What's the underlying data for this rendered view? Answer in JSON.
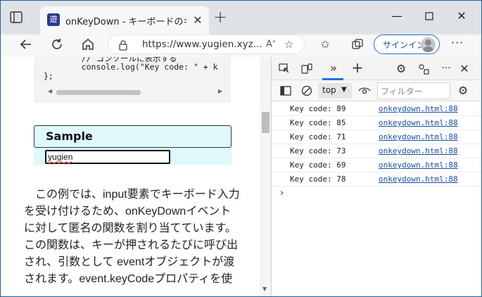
{
  "browser": {
    "tab_title": "onKeyDown - キーボードのキーが押さ",
    "favicon_char": "遊",
    "url": "https://www.yugien.xyz...",
    "signin_label": "サインイン"
  },
  "icons": {
    "tab_actions": "tab-actions-icon",
    "close": "close-icon",
    "new_tab": "plus-icon",
    "minimize": "minimize-icon",
    "maximize": "maximize-icon",
    "back": "back-arrow-icon",
    "refresh": "refresh-icon",
    "home": "home-icon",
    "lock": "lock-icon",
    "read_aloud": "read-aloud-icon",
    "add_favorite": "add-favorite-icon",
    "favorites": "favorites-icon",
    "collections": "collections-icon",
    "more": "more-icon"
  },
  "page": {
    "code_lines": [
      "    // コンソールに表示する",
      "    console.log(\"Key code: \" + k",
      "};"
    ],
    "sample_title": "Sample",
    "sample_input_value": "yugien",
    "paragraph_lines": [
      "　この例では、input要素でキーボード入力",
      "を受け付けるため、onKeyDownイベント",
      "に対して匿名の関数を割り当てています。",
      "この関数は、キーが押されるたびに呼び出",
      "され、引数として eventオブジェクトが渡",
      "されます。event.keyCodeプロパティを使"
    ]
  },
  "devtools": {
    "context": "top",
    "filter_placeholder": "フィルター",
    "logs": [
      {
        "message": "Key code: 89",
        "source": "onkeydown.html:88"
      },
      {
        "message": "Key code: 85",
        "source": "onkeydown.html:88"
      },
      {
        "message": "Key code: 71",
        "source": "onkeydown.html:88"
      },
      {
        "message": "Key code: 73",
        "source": "onkeydown.html:88"
      },
      {
        "message": "Key code: 69",
        "source": "onkeydown.html:88"
      },
      {
        "message": "Key code: 78",
        "source": "onkeydown.html:88"
      }
    ],
    "prompt_symbol": "›"
  },
  "colors": {
    "window_border": "#1f5f9e",
    "accent": "#1a73e8",
    "sample_bg": "#dff8fb",
    "link": "#1a4fa0"
  }
}
